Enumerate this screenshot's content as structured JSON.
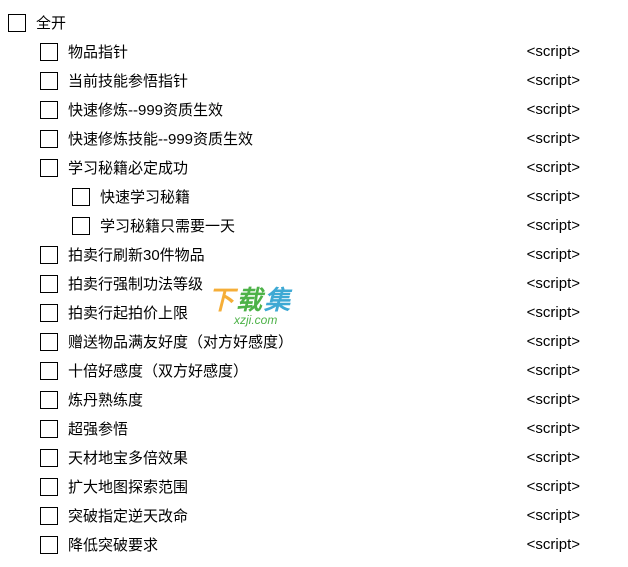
{
  "script_label": "<script>",
  "root": {
    "label": "全开"
  },
  "items": [
    {
      "label": "物品指针",
      "indent": 1,
      "script": true
    },
    {
      "label": "当前技能参悟指针",
      "indent": 1,
      "script": true
    },
    {
      "label": "快速修炼--999资质生效",
      "indent": 1,
      "script": true
    },
    {
      "label": "快速修炼技能--999资质生效",
      "indent": 1,
      "script": true
    },
    {
      "label": "学习秘籍必定成功",
      "indent": 1,
      "script": true
    },
    {
      "label": "快速学习秘籍",
      "indent": 2,
      "script": true
    },
    {
      "label": "学习秘籍只需要一天",
      "indent": 2,
      "script": true
    },
    {
      "label": "拍卖行刷新30件物品",
      "indent": 1,
      "script": true
    },
    {
      "label": "拍卖行强制功法等级",
      "indent": 1,
      "script": true
    },
    {
      "label": "拍卖行起拍价上限",
      "indent": 1,
      "script": true
    },
    {
      "label": "赠送物品满友好度（对方好感度）",
      "indent": 1,
      "script": true
    },
    {
      "label": "十倍好感度（双方好感度）",
      "indent": 1,
      "script": true
    },
    {
      "label": "炼丹熟练度",
      "indent": 1,
      "script": true
    },
    {
      "label": "超强参悟",
      "indent": 1,
      "script": true
    },
    {
      "label": "天材地宝多倍效果",
      "indent": 1,
      "script": true
    },
    {
      "label": "扩大地图探索范围",
      "indent": 1,
      "script": true
    },
    {
      "label": "突破指定逆天改命",
      "indent": 1,
      "script": true
    },
    {
      "label": "降低突破要求",
      "indent": 1,
      "script": true
    }
  ],
  "watermark": {
    "text": "下载集",
    "url": "xzji.com"
  }
}
